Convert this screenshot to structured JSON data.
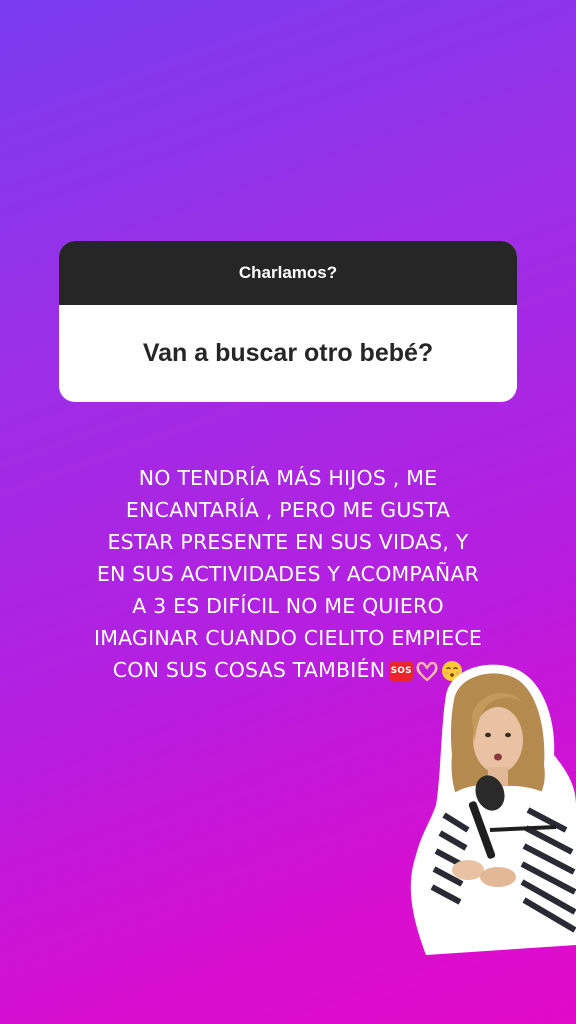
{
  "story": {
    "question_box": {
      "title": "Charlamos?",
      "question": "Van a buscar otro bebé?"
    },
    "answer": {
      "lines": [
        "NO TENDRÍA MÁS HIJOS , ME",
        "ENCANTARÍA , PERO ME GUSTA",
        "ESTAR PRESENTE EN SUS VIDAS, Y",
        "EN SUS ACTIVIDADES Y ACOMPAÑAR",
        "A 3 ES DIFÍCIL NO ME QUIERO",
        "IMAGINAR CUANDO CIELITO EMPIECE",
        "CON SUS COSAS TAMBIÉN"
      ],
      "emojis": {
        "sos": "SOS",
        "heart_hands": "heart-hands-icon",
        "kiss_face": "kissing-face-icon"
      }
    },
    "colors": {
      "gradient_start": "#7a3cf0",
      "gradient_end": "#e00ac8",
      "card_header": "#262626",
      "sos_red": "#e8262c"
    }
  }
}
